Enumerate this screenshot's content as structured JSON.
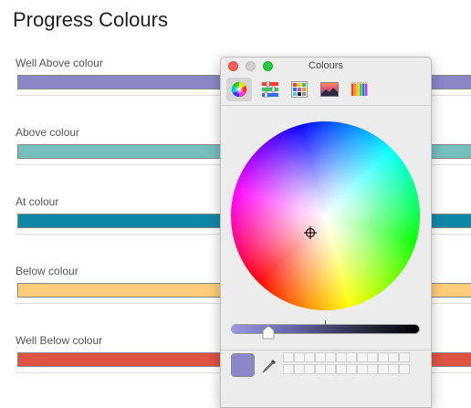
{
  "page": {
    "title": "Progress Colours"
  },
  "fields": [
    {
      "label": "Well Above colour",
      "color": "#8a86c8"
    },
    {
      "label": "Above colour",
      "color": "#75bfbd"
    },
    {
      "label": "At colour",
      "color": "#0f88a8"
    },
    {
      "label": "Below colour",
      "color": "#ffcd7b"
    },
    {
      "label": "Well Below colour",
      "color": "#de5443"
    }
  ],
  "colour_panel": {
    "title": "Colours",
    "tools": [
      "colour-wheel-icon",
      "colour-sliders-icon",
      "colour-palettes-icon",
      "image-palettes-icon",
      "pencils-icon"
    ],
    "active_tool": "colour-wheel-icon",
    "brightness_level": 0.2,
    "current_color": "#8a86c8",
    "saved_swatch_slots": 24
  }
}
